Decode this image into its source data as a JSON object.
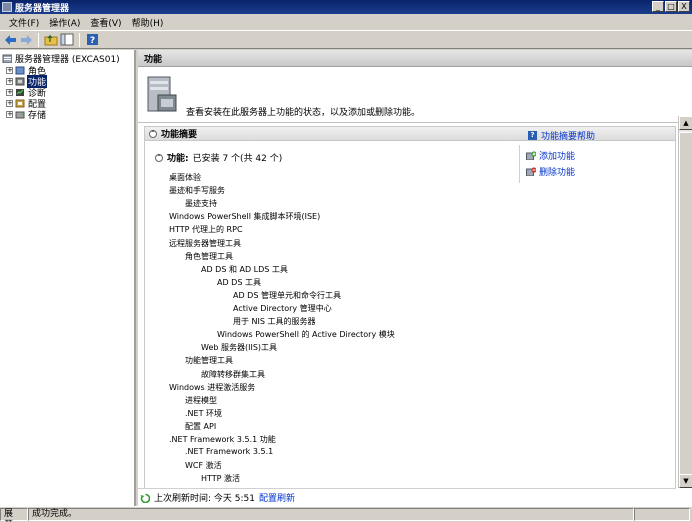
{
  "window": {
    "title": "服务器管理器"
  },
  "window_buttons": [
    "_",
    "□",
    "X"
  ],
  "menu": [
    "文件(F)",
    "操作(A)",
    "查看(V)",
    "帮助(H)"
  ],
  "tree": {
    "root": "服务器管理器 (EXCAS01)",
    "items": [
      "角色",
      "功能",
      "诊断",
      "配置",
      "存储"
    ],
    "selected": "功能"
  },
  "content": {
    "header": "功能",
    "description": "查看安装在此服务器上功能的状态，以及添加或删除功能。",
    "section_title": "功能摘要",
    "help_link": "功能摘要帮助",
    "summary_label": "功能:",
    "summary_value": "已安装 7 个(共 42 个)",
    "actions": [
      "添加功能",
      "删除功能"
    ],
    "features": [
      {
        "label": "桌面体验",
        "level": 0
      },
      {
        "label": "墨迹和手写服务",
        "level": 0
      },
      {
        "label": "墨迹支持",
        "level": 1
      },
      {
        "label": "Windows PowerShell 集成脚本环境(ISE)",
        "level": 0
      },
      {
        "label": "HTTP 代理上的 RPC",
        "level": 0
      },
      {
        "label": "远程服务器管理工具",
        "level": 0
      },
      {
        "label": "角色管理工具",
        "level": 1
      },
      {
        "label": "AD DS 和 AD LDS 工具",
        "level": 2
      },
      {
        "label": "AD DS 工具",
        "level": 3
      },
      {
        "label": "AD DS 管理单元和命令行工具",
        "level": 4
      },
      {
        "label": "Active Directory 管理中心",
        "level": 4
      },
      {
        "label": "用于 NIS 工具的服务器",
        "level": 4
      },
      {
        "label": "Windows PowerShell 的 Active Directory 模块",
        "level": 3
      },
      {
        "label": "Web 服务器(IIS)工具",
        "level": 2
      },
      {
        "label": "功能管理工具",
        "level": 1
      },
      {
        "label": "故障转移群集工具",
        "level": 2
      },
      {
        "label": "Windows 进程激活服务",
        "level": 0
      },
      {
        "label": "进程模型",
        "level": 1
      },
      {
        "label": ".NET 环境",
        "level": 1
      },
      {
        "label": "配置 API",
        "level": 1
      },
      {
        "label": ".NET Framework 3.5.1 功能",
        "level": 0
      },
      {
        "label": ".NET Framework 3.5.1",
        "level": 1
      },
      {
        "label": "WCF 激活",
        "level": 1
      },
      {
        "label": "HTTP 激活",
        "level": 2
      }
    ],
    "refresh_text": "上次刷新时间: 今天 5:51",
    "refresh_link": "配置刷新"
  },
  "status": {
    "left": "展开:",
    "message": "成功完成。"
  }
}
